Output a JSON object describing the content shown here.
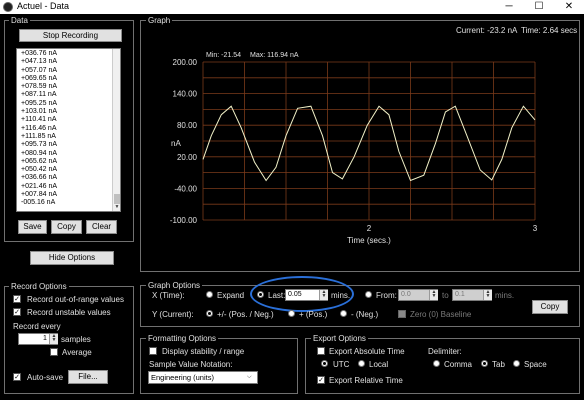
{
  "window": {
    "title": "Actuel - Data",
    "minimize": "─",
    "maximize": "☐",
    "close": "✕"
  },
  "data_panel": {
    "legend": "Data",
    "stop_label": "Stop Recording",
    "values": [
      "+036.76 nA",
      "+047.13 nA",
      "+057.07 nA",
      "+069.65 nA",
      "+078.59 nA",
      "+087.11 nA",
      "+095.25 nA",
      "+103.01 nA",
      "+110.41 nA",
      "+116.46 nA",
      "+111.85 nA",
      "+095.73 nA",
      "+080.94 nA",
      "+065.62 nA",
      "+050.42 nA",
      "+036.66 nA",
      "+021.46 nA",
      "+007.84 nA",
      "-005.16 nA"
    ],
    "save_label": "Save",
    "copy_label": "Copy",
    "clear_label": "Clear"
  },
  "hide_options_label": "Hide Options",
  "graph_panel": {
    "legend": "Graph",
    "current": "Current: -23.2 nA",
    "time": "Time: 2.64 secs",
    "min_text": "Min: -21.54",
    "max_text": "Max: 116.94 nA"
  },
  "chart_data": {
    "type": "line",
    "title": "",
    "xlabel": "Time (secs.)",
    "ylabel": "nA",
    "xlim": [
      1,
      3
    ],
    "ylim": [
      -100,
      200
    ],
    "x_ticks": [
      "2",
      "3"
    ],
    "y_ticks": [
      "200.00",
      "140.00",
      "80.00",
      "20.00",
      "-40.00",
      "-100.00"
    ],
    "grid": true,
    "line_color": "#f2f2c8",
    "grid_color": "#7a3a1a",
    "series": [
      {
        "x": [
          1.0,
          1.05,
          1.11,
          1.17,
          1.23,
          1.31,
          1.38,
          1.44,
          1.5,
          1.57,
          1.65,
          1.72,
          1.78,
          1.84,
          1.91,
          1.99,
          2.06,
          2.12,
          2.18,
          2.25,
          2.33,
          2.4,
          2.46,
          2.52,
          2.59,
          2.67,
          2.74,
          2.8,
          2.86,
          2.93,
          3.0
        ],
        "y": [
          15,
          60,
          100,
          116,
          75,
          10,
          -25,
          0,
          60,
          112,
          116,
          60,
          -10,
          -22,
          20,
          80,
          116,
          100,
          30,
          -25,
          -15,
          45,
          105,
          116,
          60,
          -5,
          -24,
          15,
          75,
          116,
          90
        ]
      }
    ]
  },
  "record_options": {
    "legend": "Record Options",
    "out_of_range": "Record out-of-range values",
    "unstable": "Record unstable values",
    "record_every": "Record every",
    "samples_value": "1",
    "samples_label": "samples",
    "average": "Average",
    "autosave": "Auto-save",
    "file_label": "File..."
  },
  "graph_options": {
    "legend": "Graph Options",
    "x_label": "X (Time):",
    "expand": "Expand",
    "last": "Last:",
    "last_value": "0.05",
    "mins": "mins.",
    "from": "From:",
    "from_value": "0.0",
    "to": "to",
    "to_value": "0.1",
    "mins2": "mins.",
    "y_label": "Y (Current):",
    "pos_neg": "+/- (Pos. / Neg.)",
    "pos": "+ (Pos.)",
    "neg": "- (Neg.)",
    "zero_baseline": "Zero (0) Baseline",
    "copy_label": "Copy"
  },
  "formatting_options": {
    "legend": "Formatting Options",
    "display_stability": "Display stability / range",
    "notation_label": "Sample Value Notation:",
    "notation_value": "Engineering (units)"
  },
  "export_options": {
    "legend": "Export Options",
    "absolute_time": "Export Absolute Time",
    "utc": "UTC",
    "local": "Local",
    "delimiter": "Delimiter:",
    "comma": "Comma",
    "tab": "Tab",
    "space": "Space",
    "relative_time": "Export Relative Time"
  }
}
